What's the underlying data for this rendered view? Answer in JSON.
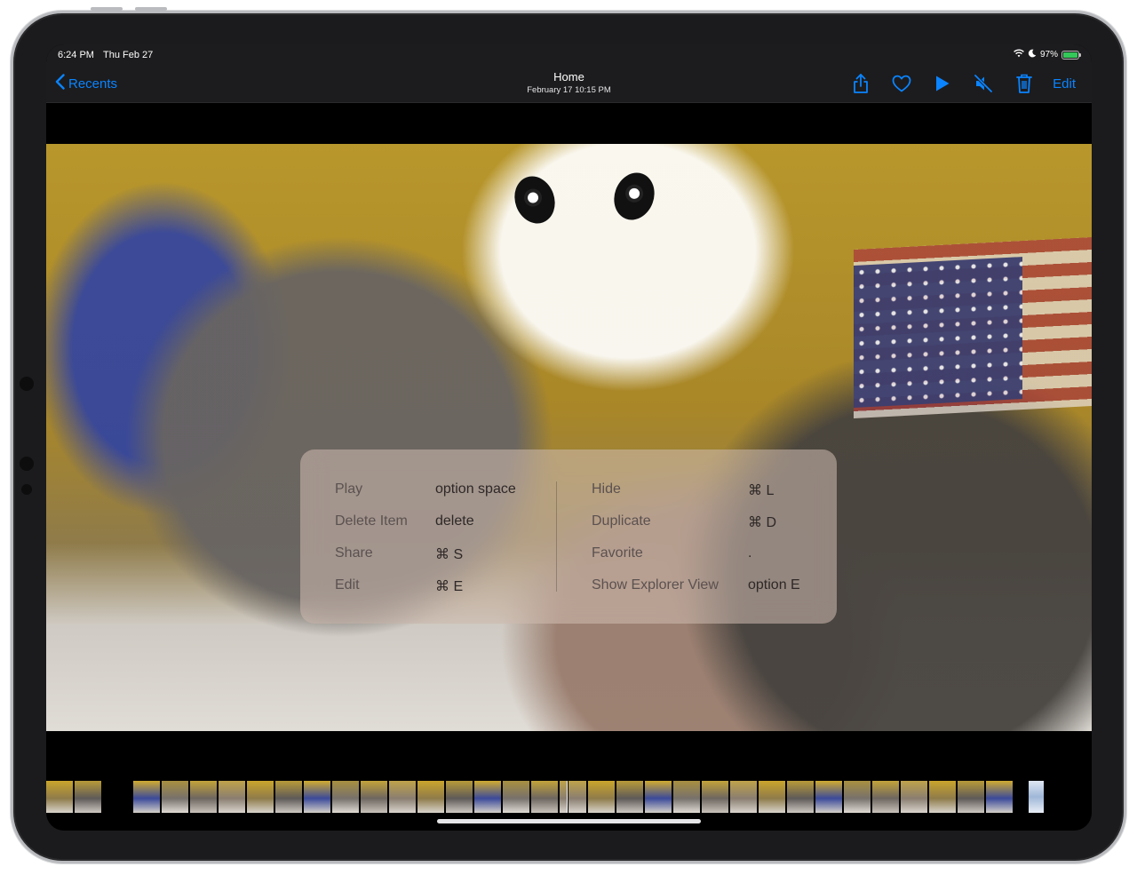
{
  "status_bar": {
    "time": "6:24 PM",
    "date": "Thu Feb 27",
    "battery_percent_label": "97%",
    "battery_level": 0.97,
    "icons": [
      "wifi-icon",
      "moon-icon",
      "battery-icon"
    ]
  },
  "nav": {
    "back_label": "Recents",
    "title": "Home",
    "subtitle": "February 17  10:15 PM",
    "edit_label": "Edit",
    "actions": [
      "share-icon",
      "heart-icon",
      "play-icon",
      "speaker-muted-icon",
      "trash-icon"
    ],
    "accent_color": "#0a84ff"
  },
  "shortcuts": {
    "left": [
      {
        "command": "Play",
        "key": "option space"
      },
      {
        "command": "Delete Item",
        "key": "delete"
      },
      {
        "command": "Share",
        "key": "⌘  S"
      },
      {
        "command": "Edit",
        "key": "⌘  E"
      }
    ],
    "right": [
      {
        "command": "Hide",
        "key": "⌘  L"
      },
      {
        "command": "Duplicate",
        "key": "⌘  D"
      },
      {
        "command": "Favorite",
        "key": "."
      },
      {
        "command": "Show Explorer View",
        "key": "option E"
      }
    ]
  },
  "filmstrip": {
    "thumbnail_count": 34
  }
}
